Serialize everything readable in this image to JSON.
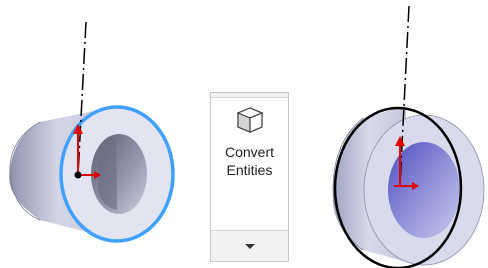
{
  "ribbon": {
    "convert_entities": {
      "label": "Convert\nEntities",
      "icon": "cube-icon"
    },
    "dropdown": {
      "icon": "chevron-down-icon"
    }
  },
  "colors": {
    "edge_highlight": "#3fa0ff",
    "face_outline": "#000000",
    "axis_y": "#e00000",
    "axis_x": "#e00000",
    "body_light": "#e6e8f4",
    "body_dark": "#8f92ac"
  }
}
